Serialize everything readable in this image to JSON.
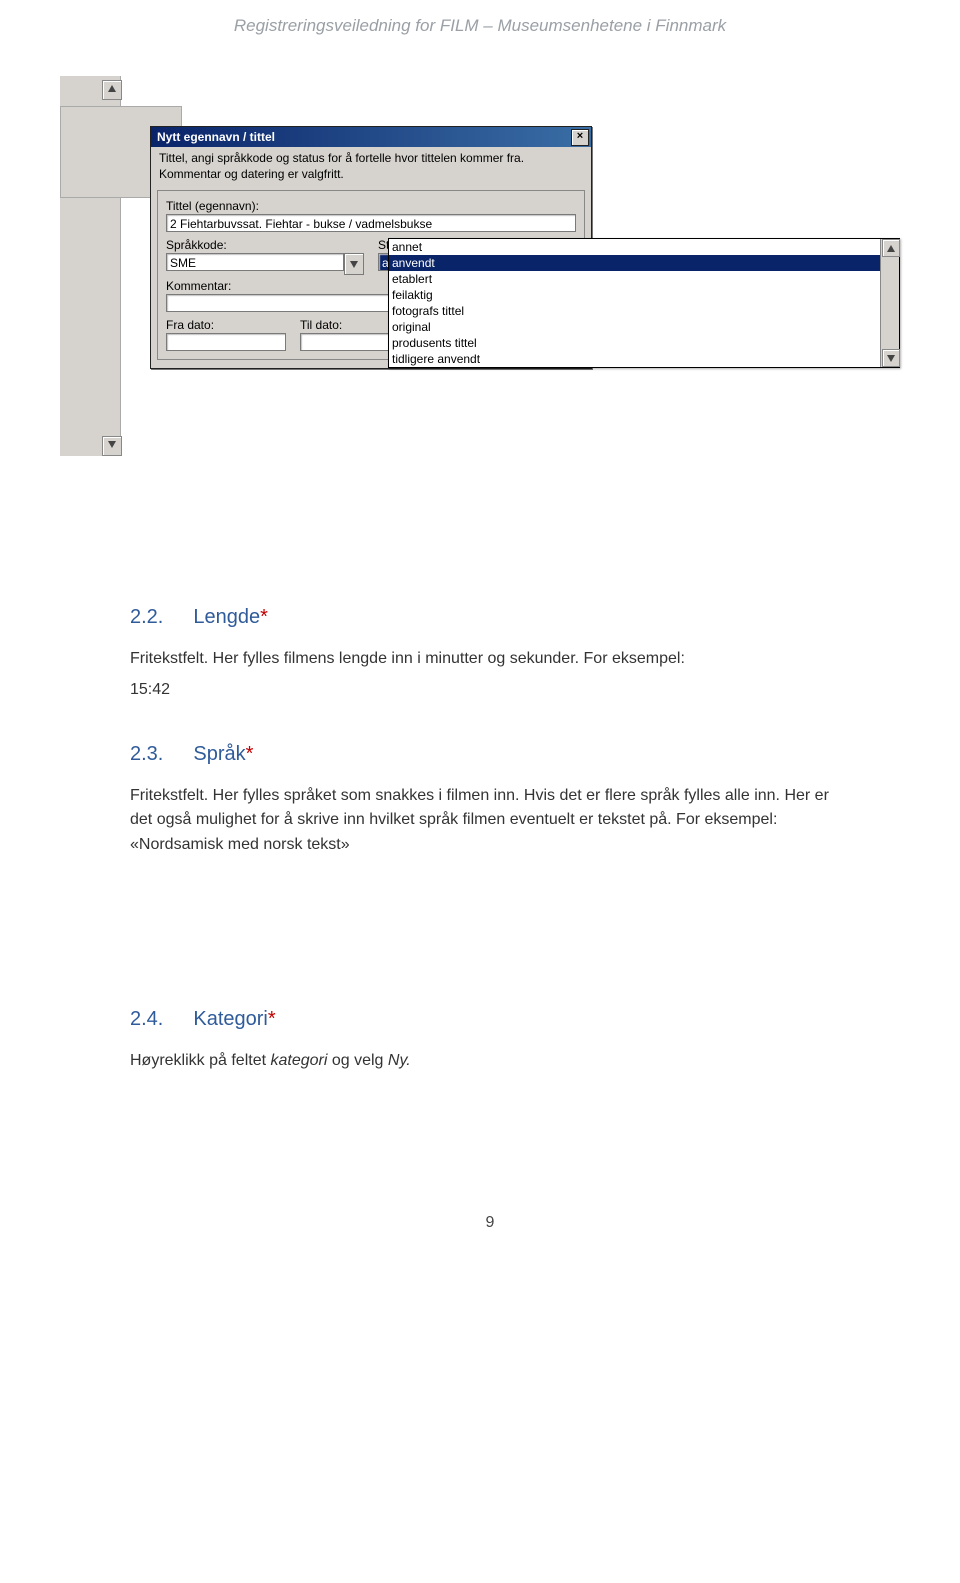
{
  "header": "Registreringsveiledning for FILM – Museumsenhetene i Finnmark",
  "dialog": {
    "title": "Nytt egennavn / tittel",
    "description_line1": "Tittel, angi språkkode og status for å fortelle hvor tittelen kommer fra.",
    "description_line2": "Kommentar og datering er valgfritt.",
    "labels": {
      "tittel": "Tittel (egennavn):",
      "sprakkode": "Språkkode:",
      "status": "Status:",
      "kommentar": "Kommentar:",
      "fra": "Fra dato:",
      "til": "Til dato:"
    },
    "values": {
      "tittel": "2 Fiehtarbuvssat. Fiehtar - bukse / vadmelsbukse",
      "sprakkode": "SME",
      "status": "anvendt",
      "kommentar": "",
      "fra": "",
      "til": ""
    },
    "close": "×"
  },
  "dropdown": {
    "items": [
      "annet",
      "anvendt",
      "etablert",
      "feilaktig",
      "fotografs tittel",
      "original",
      "produsents tittel",
      "tidligere anvendt"
    ],
    "selected_index": 1
  },
  "sections": {
    "s22": {
      "num": "2.2.",
      "title": "Lengde",
      "star": "*"
    },
    "s22_p1a": "Fritekstfelt. Her fylles filmens lengde inn i minutter og sekunder. For eksempel:",
    "s22_p1b": "15:42",
    "s23": {
      "num": "2.3.",
      "title": "Språk",
      "star": "*"
    },
    "s23_p1": "Fritekstfelt. Her fylles språket som snakkes i filmen inn. Hvis det er flere språk fylles alle inn. Her er det også mulighet for å skrive inn hvilket språk filmen eventuelt er tekstet på. For eksempel: «Nordsamisk med norsk tekst»",
    "s24": {
      "num": "2.4.",
      "title": "Kategori",
      "star": "*"
    },
    "s24_p1a": "Høyreklikk på feltet ",
    "s24_p1b": "kategori",
    "s24_p1c": " og velg ",
    "s24_p1d": "Ny.",
    "page": "9"
  }
}
